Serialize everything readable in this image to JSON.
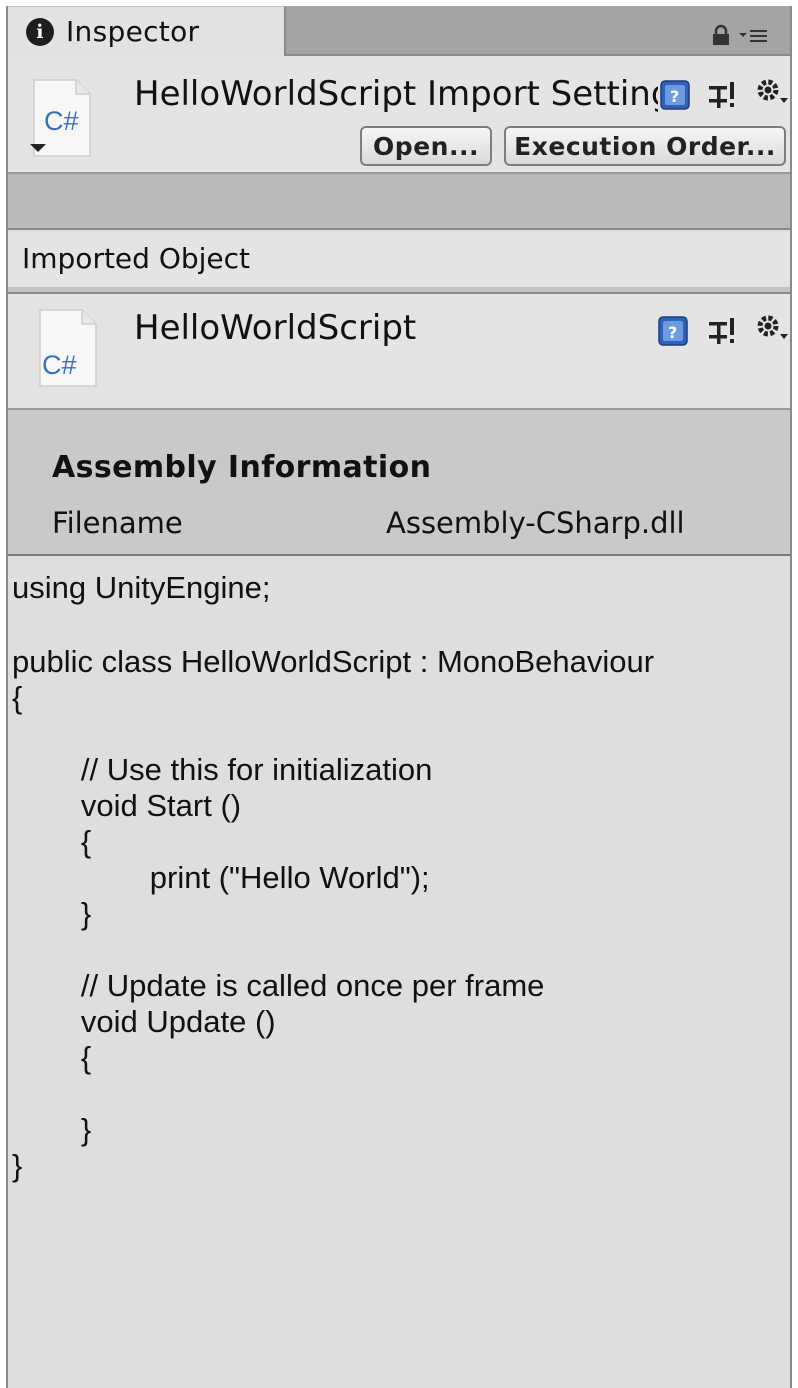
{
  "tab": {
    "label": "Inspector",
    "info_glyph": "i"
  },
  "import_settings": {
    "title": "HelloWorldScript Import Settings",
    "file_icon_text": "C#",
    "open_button": "Open...",
    "execution_order_button": "Execution Order..."
  },
  "imported_object": {
    "section_label": "Imported Object",
    "title": "HelloWorldScript",
    "file_icon_text": "C#"
  },
  "assembly": {
    "heading": "Assembly Information",
    "filename_label": "Filename",
    "filename_value": "Assembly-CSharp.dll"
  },
  "code": {
    "lines": [
      "using UnityEngine;",
      "",
      "public class HelloWorldScript : MonoBehaviour",
      "{",
      "",
      "        // Use this for initialization",
      "        void Start ()",
      "        {",
      "                print (\"Hello World\");",
      "        }",
      "",
      "        // Update is called once per frame",
      "        void Update ()",
      "        {",
      "",
      "        }",
      "}"
    ]
  },
  "colors": {
    "csharp_blue": "#3a6fc4",
    "help_blue": "#2f62b8"
  }
}
